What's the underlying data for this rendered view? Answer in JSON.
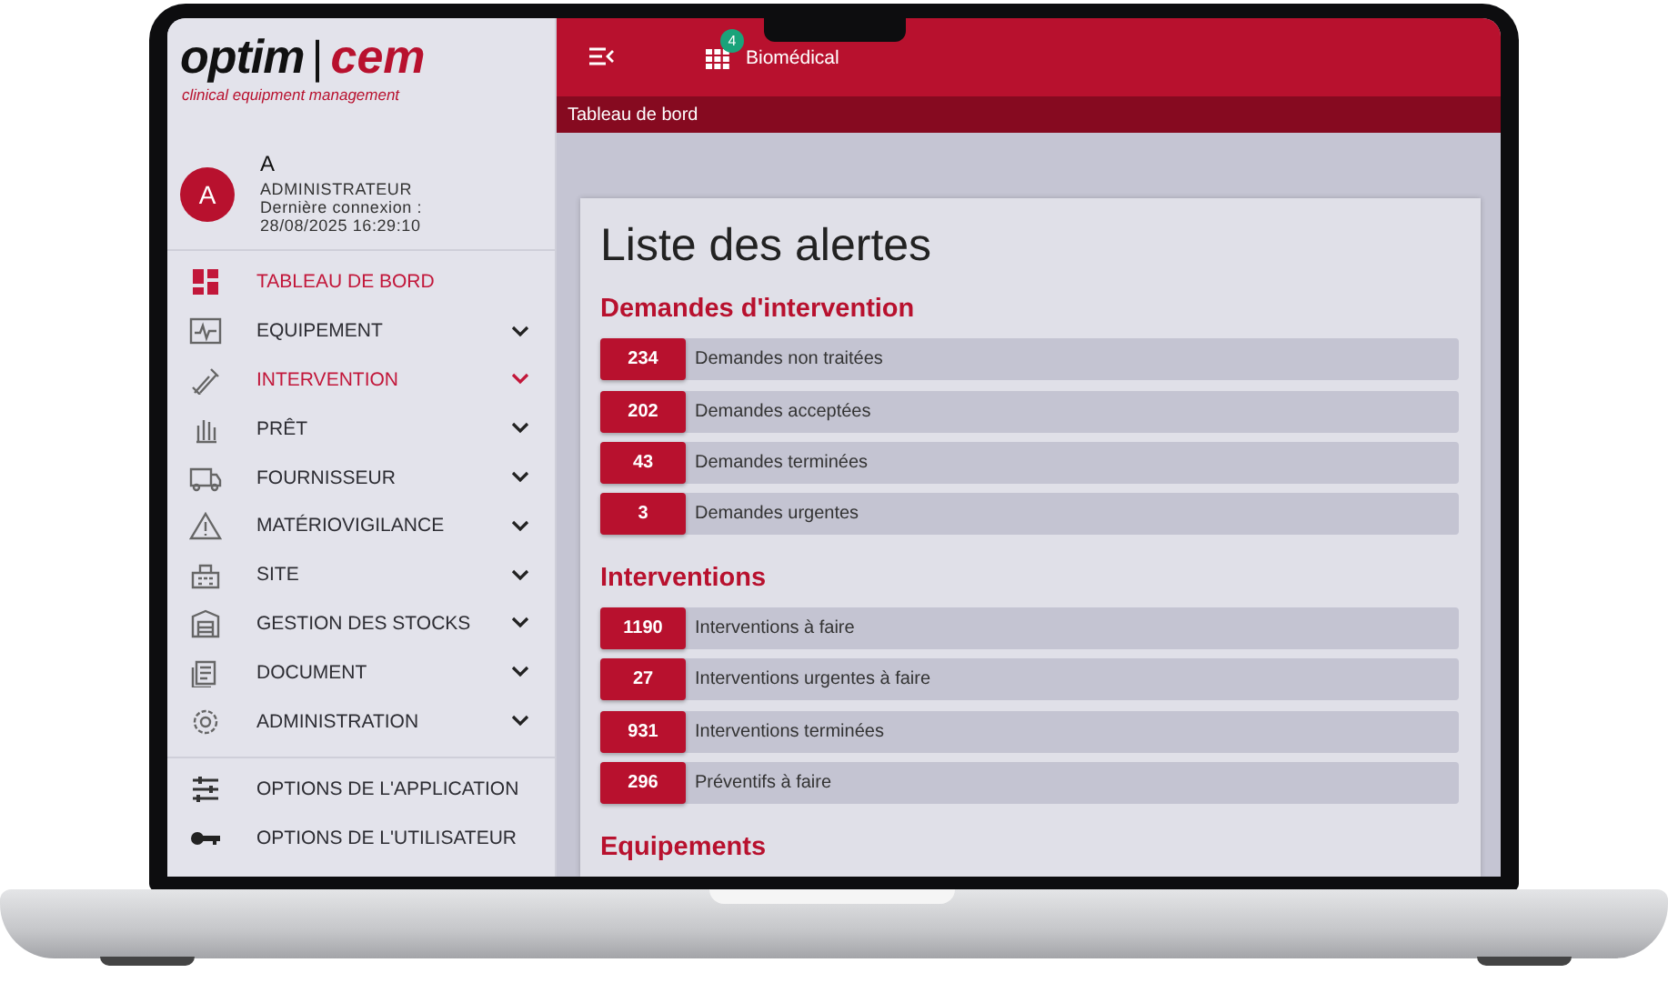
{
  "logo": {
    "word_1": "optim",
    "separator": "|",
    "word_2": "cem",
    "tagline": "clinical equipment management"
  },
  "user": {
    "avatar": "A",
    "name": "A",
    "role": "ADMINISTRATEUR",
    "last_login_label": "Dernière connexion :",
    "last_login": "28/08/2025 16:29:10"
  },
  "sidebar": {
    "items": [
      {
        "label": "TABLEAU DE BORD",
        "selected": true,
        "has_submenu": false
      },
      {
        "label": "EQUIPEMENT",
        "selected": false,
        "has_submenu": true
      },
      {
        "label": "INTERVENTION",
        "selected": true,
        "has_submenu": true
      },
      {
        "label": "PRÊT",
        "selected": false,
        "has_submenu": true
      },
      {
        "label": "FOURNISSEUR",
        "selected": false,
        "has_submenu": true
      },
      {
        "label": "MATÉRIOVIGILANCE",
        "selected": false,
        "has_submenu": true
      },
      {
        "label": "SITE",
        "selected": false,
        "has_submenu": true
      },
      {
        "label": "GESTION DES STOCKS",
        "selected": false,
        "has_submenu": true
      },
      {
        "label": "DOCUMENT",
        "selected": false,
        "has_submenu": true
      },
      {
        "label": "ADMINISTRATION",
        "selected": false,
        "has_submenu": true
      }
    ],
    "footer_items": [
      {
        "label": "OPTIONS DE L'APPLICATION"
      },
      {
        "label": "OPTIONS DE L'UTILISATEUR"
      }
    ]
  },
  "header": {
    "module": "Biomédical",
    "badge": "4"
  },
  "breadcrumb": "Tableau de bord",
  "page": {
    "title": "Liste des alertes",
    "sections": [
      {
        "title": "Demandes d'intervention",
        "alerts": [
          {
            "count": "234",
            "label": "Demandes non traitées"
          },
          {
            "count": "202",
            "label": "Demandes acceptées"
          },
          {
            "count": "43",
            "label": "Demandes terminées"
          },
          {
            "count": "3",
            "label": "Demandes urgentes"
          }
        ]
      },
      {
        "title": "Interventions",
        "alerts": [
          {
            "count": "1190",
            "label": "Interventions à faire"
          },
          {
            "count": "27",
            "label": "Interventions urgentes à faire"
          },
          {
            "count": "931",
            "label": "Interventions terminées"
          },
          {
            "count": "296",
            "label": "Préventifs à faire"
          }
        ]
      },
      {
        "title": "Equipements"
      }
    ]
  }
}
